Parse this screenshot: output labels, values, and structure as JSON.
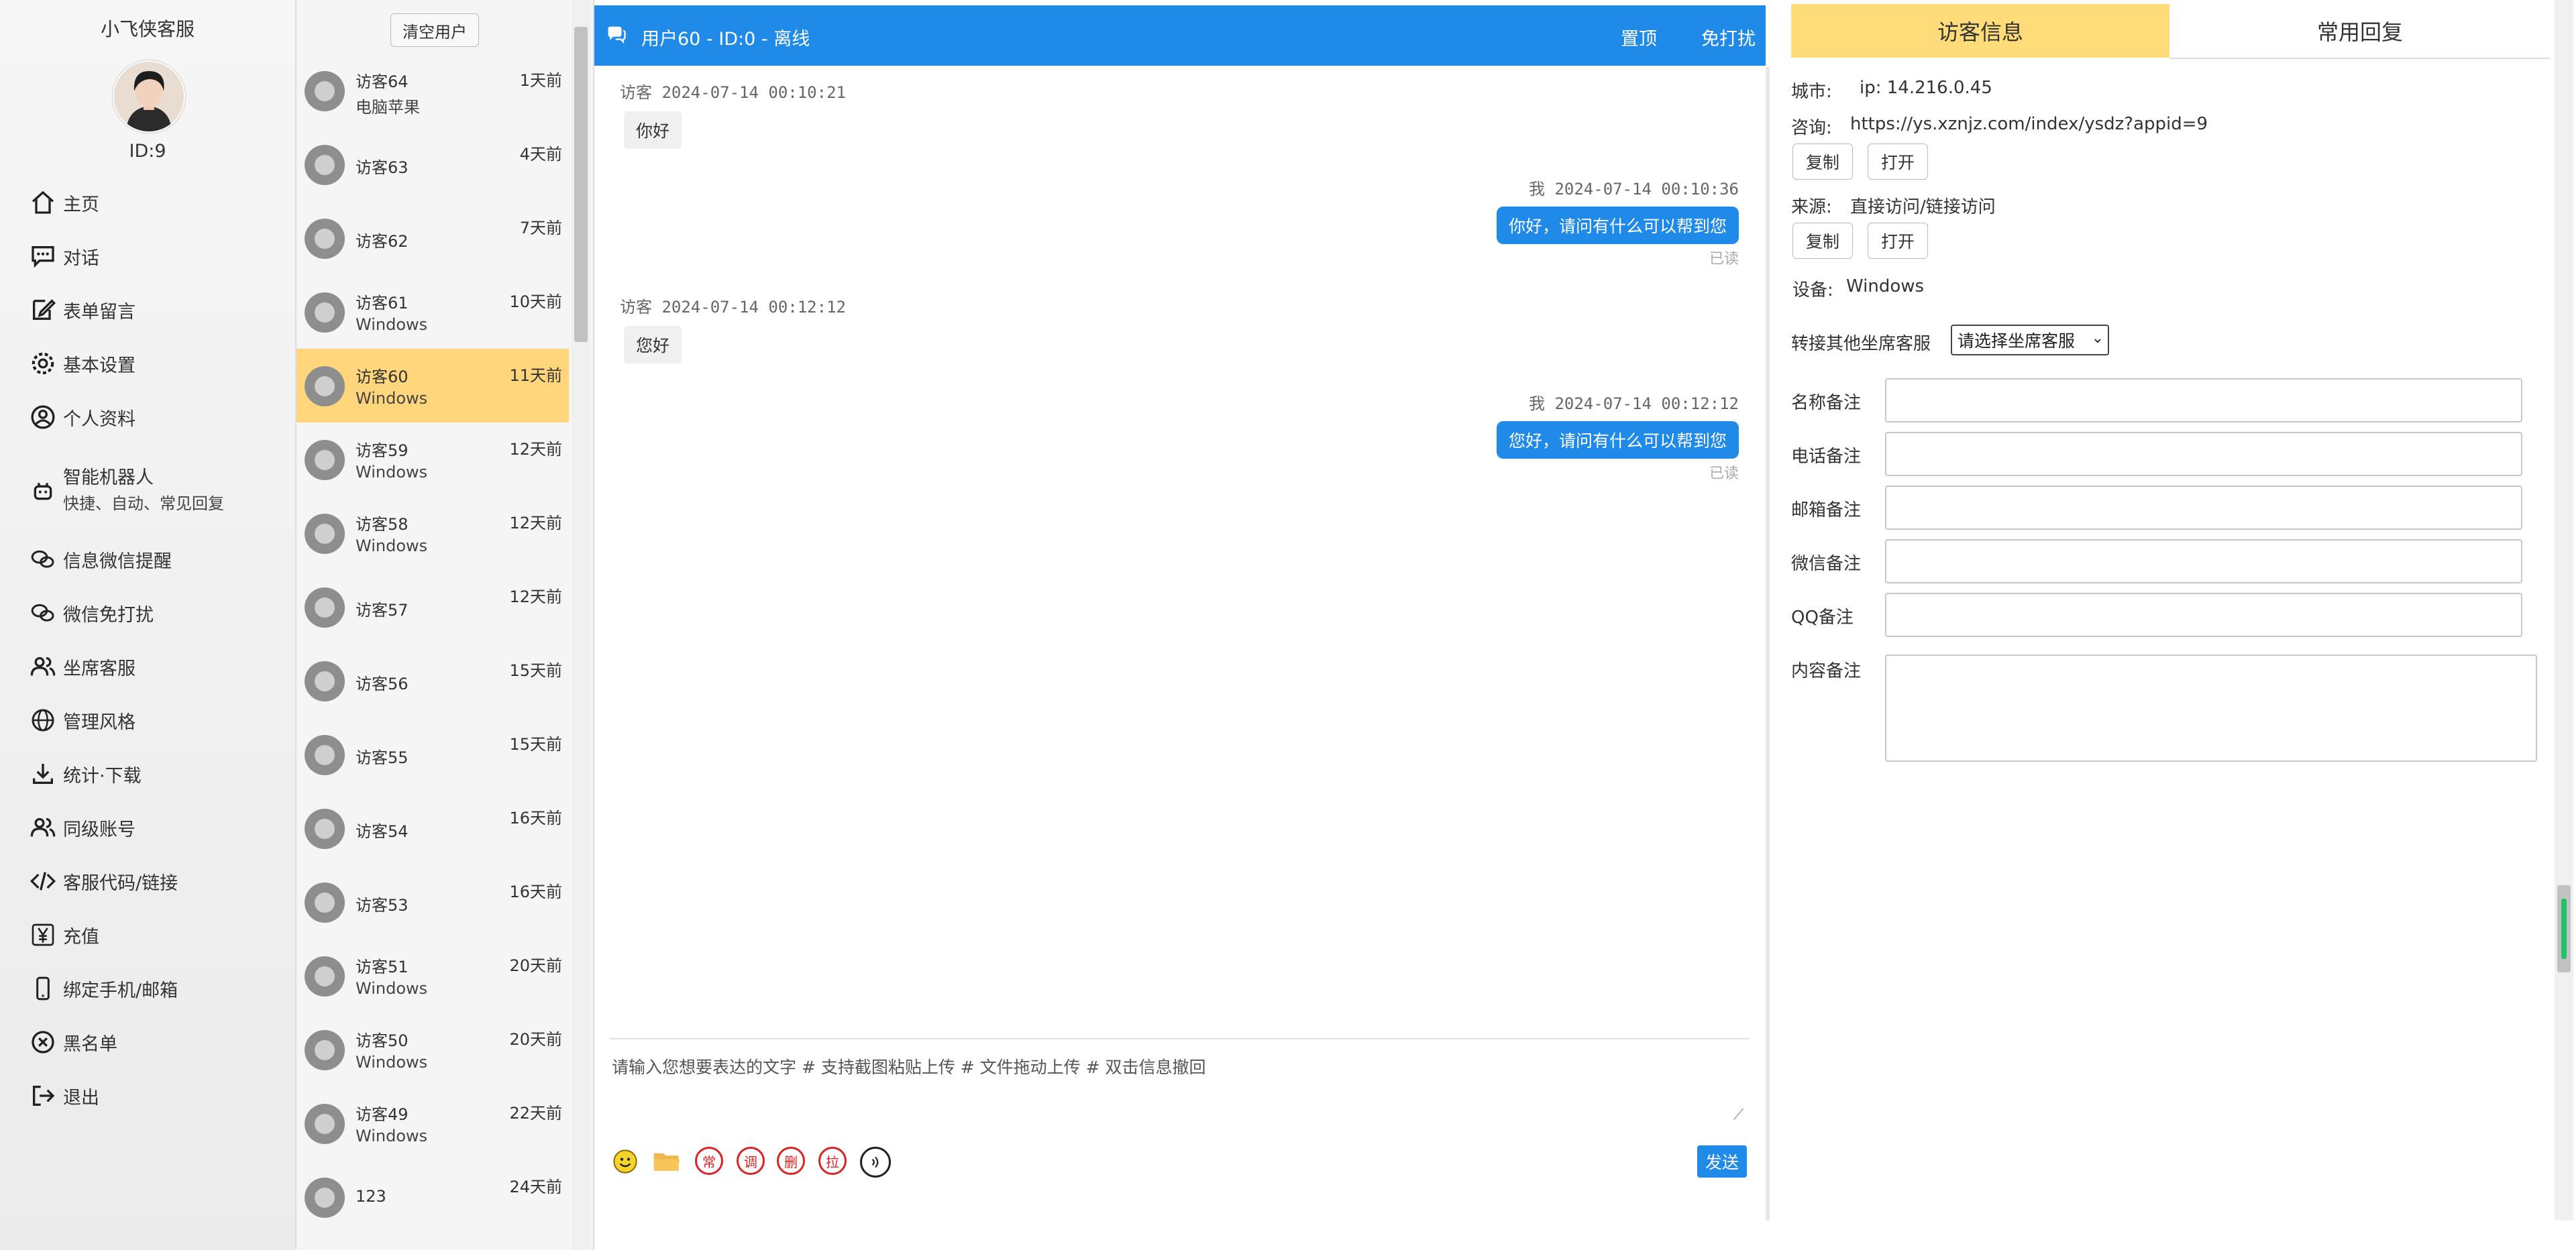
{
  "nav": {
    "brand": "小飞侠客服",
    "user_id": "ID:9",
    "items": [
      {
        "label": "主页",
        "icon": "home-icon"
      },
      {
        "label": "对话",
        "icon": "chat-icon"
      },
      {
        "label": "表单留言",
        "icon": "form-edit-icon"
      },
      {
        "label": "基本设置",
        "icon": "gear-icon"
      },
      {
        "label": "个人资料",
        "icon": "user-circle-icon"
      },
      {
        "label": "智能机器人",
        "sub": "快捷、自动、常见回复",
        "icon": "robot-icon"
      },
      {
        "label": "信息微信提醒",
        "icon": "wechat-icon"
      },
      {
        "label": "微信免打扰",
        "icon": "wechat-mute-icon"
      },
      {
        "label": "坐席客服",
        "icon": "users-icon"
      },
      {
        "label": "管理风格",
        "icon": "globe-icon"
      },
      {
        "label": "统计·下载",
        "icon": "download-icon"
      },
      {
        "label": "同级账号",
        "icon": "team-icon"
      },
      {
        "label": "客服代码/链接",
        "icon": "code-icon"
      },
      {
        "label": "充值",
        "icon": "yen-icon"
      },
      {
        "label": "绑定手机/邮箱",
        "icon": "phone-icon"
      },
      {
        "label": "黑名单",
        "icon": "block-icon"
      },
      {
        "label": "退出",
        "icon": "logout-icon"
      }
    ]
  },
  "visitors": {
    "clear_label": "清空用户",
    "items": [
      {
        "name": "访客64",
        "sub": "电脑苹果",
        "time": "1天前"
      },
      {
        "name": "访客63",
        "sub": "",
        "time": "4天前"
      },
      {
        "name": "访客62",
        "sub": "",
        "time": "7天前"
      },
      {
        "name": "访客61",
        "sub": "Windows",
        "time": "10天前"
      },
      {
        "name": "访客60",
        "sub": "Windows",
        "time": "11天前"
      },
      {
        "name": "访客59",
        "sub": "Windows",
        "time": "12天前"
      },
      {
        "name": "访客58",
        "sub": "Windows",
        "time": "12天前"
      },
      {
        "name": "访客57",
        "sub": "",
        "time": "12天前"
      },
      {
        "name": "访客56",
        "sub": "",
        "time": "15天前"
      },
      {
        "name": "访客55",
        "sub": "",
        "time": "15天前"
      },
      {
        "name": "访客54",
        "sub": "",
        "time": "16天前"
      },
      {
        "name": "访客53",
        "sub": "",
        "time": "16天前"
      },
      {
        "name": "访客51",
        "sub": "Windows",
        "time": "20天前"
      },
      {
        "name": "访客50",
        "sub": "Windows",
        "time": "20天前"
      },
      {
        "name": "访客49",
        "sub": "Windows",
        "time": "22天前"
      },
      {
        "name": "123",
        "sub": "",
        "time": "24天前"
      }
    ]
  },
  "chat": {
    "title": "用户60 - ID:0 - 离线",
    "pin_label": "置顶",
    "mute_label": "免打扰",
    "messages": [
      {
        "meta": "访客 2024-07-14 00:10:21",
        "text": "你好"
      },
      {
        "meta": "我  2024-07-14 00:10:36",
        "text": "你好，请问有什么可以帮到您",
        "read": "已读"
      },
      {
        "meta": "访客 2024-07-14 00:12:12",
        "text": "您好"
      },
      {
        "meta": "我  2024-07-14 00:12:12",
        "text": "您好，请问有什么可以帮到您",
        "read": "已读"
      }
    ],
    "input_placeholder": "请输入您想要表达的文字 # 支持截图粘贴上传 # 文件拖动上传 # 双击信息撤回",
    "tools": [
      "常",
      "调",
      "删",
      "拉"
    ],
    "send_label": "发送"
  },
  "panel": {
    "tab_visitor": "访客信息",
    "tab_replies": "常用回复",
    "city_label": "城市:",
    "city_value": "ip: 14.216.0.45",
    "consult_label": "咨询:",
    "consult_value": "https://ys.xznjz.com/index/ysdz?appid=9",
    "copy_label": "复制",
    "open_label": "打开",
    "source_label": "来源:",
    "source_value": "直接访问/链接访问",
    "device_label": "设备:",
    "device_value": "Windows",
    "transfer_label": "转接其他坐席客服",
    "transfer_select": "请选择坐席客服",
    "fields": [
      "名称备注",
      "电话备注",
      "邮箱备注",
      "微信备注",
      "QQ备注",
      "内容备注"
    ]
  }
}
